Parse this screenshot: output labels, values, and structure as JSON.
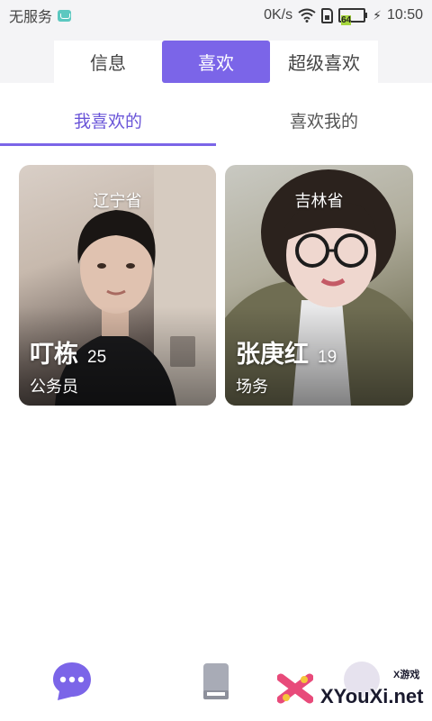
{
  "status_bar": {
    "carrier": "无服务",
    "speed": "0K/s",
    "battery": "64",
    "time": "10:50"
  },
  "top_tabs": [
    {
      "label": "信息",
      "active": false
    },
    {
      "label": "喜欢",
      "active": true
    },
    {
      "label": "超级喜欢",
      "active": false
    }
  ],
  "sub_tabs": [
    {
      "label": "我喜欢的",
      "active": true
    },
    {
      "label": "喜欢我的",
      "active": false
    }
  ],
  "cards": [
    {
      "province": "辽宁省",
      "name": "叮栋",
      "age": "25",
      "job": "公务员"
    },
    {
      "province": "吉林省",
      "name": "张庚红",
      "age": "19",
      "job": "场务"
    }
  ],
  "bottom_nav": [
    {
      "icon": "chat-bubble-icon"
    },
    {
      "icon": "book-icon"
    },
    {
      "icon": "profile-icon"
    }
  ],
  "watermark": {
    "text": "XYouXi.net",
    "small_text": "X游戏"
  },
  "colors": {
    "accent": "#7b65e8",
    "battery": "#a6d63c"
  }
}
